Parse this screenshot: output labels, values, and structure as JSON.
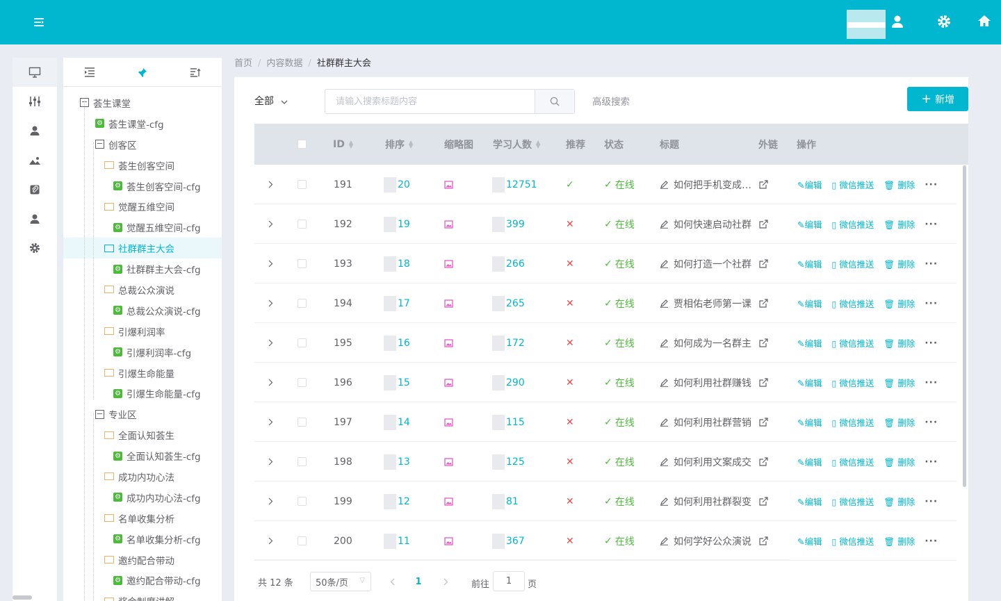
{
  "header": {
    "menu_icon": "menu-fold-icon",
    "icons": [
      "user-icon",
      "gear-icon",
      "home-icon"
    ]
  },
  "icon_bar": [
    "monitor-icon",
    "sliders-icon",
    "user-icon",
    "image-icon",
    "paperclip-icon",
    "user-icon",
    "gear-icon"
  ],
  "tree_tabs": [
    "list-indent-icon",
    "pin-icon",
    "sort-icon"
  ],
  "tree": [
    {
      "label": "荟生课堂",
      "type": "folder",
      "level": 0
    },
    {
      "label": "荟生课堂-cfg",
      "type": "cfg",
      "level": 1
    },
    {
      "label": "创客区",
      "type": "folder",
      "level": 1
    },
    {
      "label": "荟生创客空间",
      "type": "book",
      "level": 2
    },
    {
      "label": "荟生创客空间-cfg",
      "type": "cfg",
      "level": 3
    },
    {
      "label": "觉醒五维空间",
      "type": "book",
      "level": 2
    },
    {
      "label": "觉醒五维空间-cfg",
      "type": "cfg",
      "level": 3
    },
    {
      "label": "社群群主大会",
      "type": "book",
      "level": 2,
      "selected": true
    },
    {
      "label": "社群群主大会-cfg",
      "type": "cfg",
      "level": 3
    },
    {
      "label": "总裁公众演说",
      "type": "book",
      "level": 2
    },
    {
      "label": "总裁公众演说-cfg",
      "type": "cfg",
      "level": 3
    },
    {
      "label": "引爆利润率",
      "type": "book",
      "level": 2
    },
    {
      "label": "引爆利润率-cfg",
      "type": "cfg",
      "level": 3
    },
    {
      "label": "引爆生命能量",
      "type": "book",
      "level": 2
    },
    {
      "label": "引爆生命能量-cfg",
      "type": "cfg",
      "level": 3
    },
    {
      "label": "专业区",
      "type": "folder",
      "level": 1
    },
    {
      "label": "全面认知荟生",
      "type": "book",
      "level": 2
    },
    {
      "label": "全面认知荟生-cfg",
      "type": "cfg",
      "level": 3
    },
    {
      "label": "成功内功心法",
      "type": "book",
      "level": 2
    },
    {
      "label": "成功内功心法-cfg",
      "type": "cfg",
      "level": 3
    },
    {
      "label": "名单收集分析",
      "type": "book",
      "level": 2
    },
    {
      "label": "名单收集分析-cfg",
      "type": "cfg",
      "level": 3
    },
    {
      "label": "邀约配合带动",
      "type": "book",
      "level": 2
    },
    {
      "label": "邀约配合带动-cfg",
      "type": "cfg",
      "level": 3
    },
    {
      "label": "奖金制度讲解",
      "type": "book",
      "level": 2
    }
  ],
  "breadcrumb": [
    "首页",
    "内容数据",
    "社群群主大会"
  ],
  "filter": {
    "label": "全部",
    "search_placeholder": "请输入搜索标题内容",
    "advanced": "高级搜索",
    "add": "新增"
  },
  "columns": {
    "id": "ID",
    "order": "排序",
    "thumb": "缩略图",
    "learners": "学习人数",
    "recommend": "推荐",
    "status": "状态",
    "title": "标题",
    "link": "外链",
    "ops": "操作"
  },
  "actions": {
    "edit": "编辑",
    "wechat": "微信推送",
    "delete": "删除",
    "more": "···"
  },
  "rows": [
    {
      "id": "191",
      "order": "20",
      "learners": "12751",
      "recommend": true,
      "status": "在线",
      "title": "如何把手机变成印钞机"
    },
    {
      "id": "192",
      "order": "19",
      "learners": "399",
      "recommend": false,
      "status": "在线",
      "title": "如何快速启动社群"
    },
    {
      "id": "193",
      "order": "18",
      "learners": "266",
      "recommend": false,
      "status": "在线",
      "title": "如何打造一个社群"
    },
    {
      "id": "194",
      "order": "17",
      "learners": "265",
      "recommend": false,
      "status": "在线",
      "title": "贾相佑老师第一课"
    },
    {
      "id": "195",
      "order": "16",
      "learners": "172",
      "recommend": false,
      "status": "在线",
      "title": "如何成为一名群主"
    },
    {
      "id": "196",
      "order": "15",
      "learners": "290",
      "recommend": false,
      "status": "在线",
      "title": "如何利用社群赚钱"
    },
    {
      "id": "197",
      "order": "14",
      "learners": "115",
      "recommend": false,
      "status": "在线",
      "title": "如何利用社群营销"
    },
    {
      "id": "198",
      "order": "13",
      "learners": "125",
      "recommend": false,
      "status": "在线",
      "title": "如何利用文案成交"
    },
    {
      "id": "199",
      "order": "12",
      "learners": "81",
      "recommend": false,
      "status": "在线",
      "title": "如何利用社群裂变"
    },
    {
      "id": "200",
      "order": "11",
      "learners": "367",
      "recommend": false,
      "status": "在线",
      "title": "如何学好公众演说"
    }
  ],
  "pager": {
    "total": "共 12 条",
    "size": "50条/页",
    "current": "1",
    "goto_label": "前往",
    "goto_value": "1",
    "goto_suffix": "页"
  }
}
